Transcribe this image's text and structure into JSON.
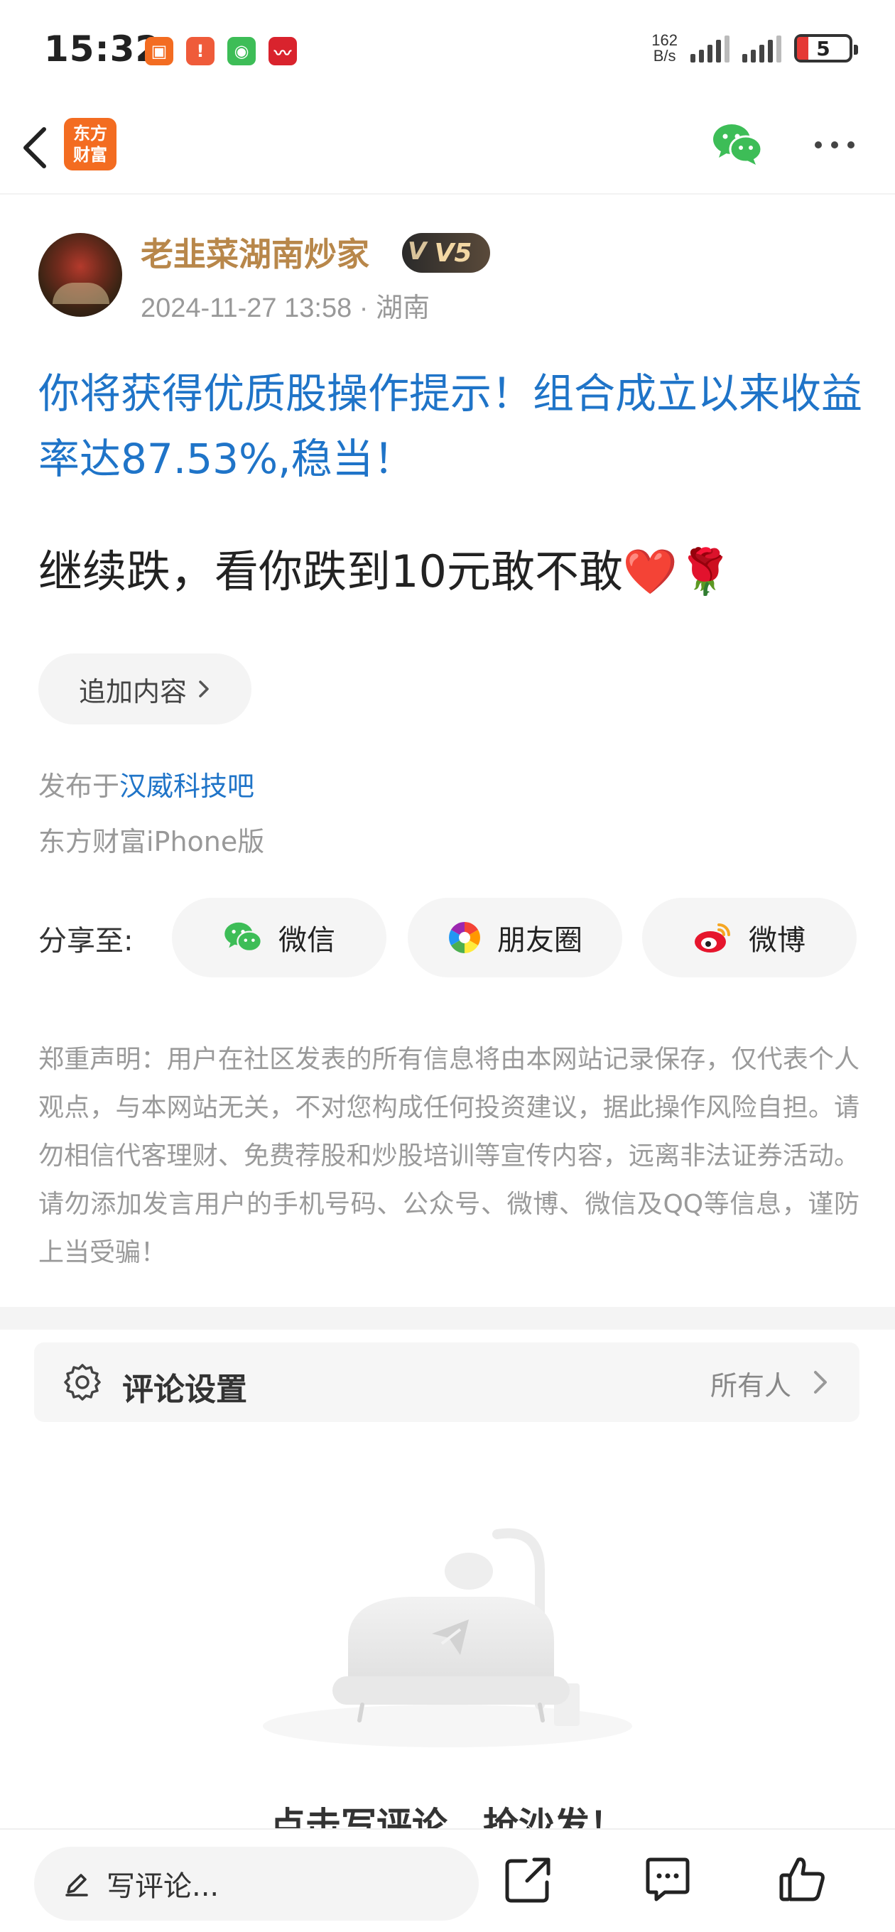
{
  "status_bar": {
    "time": "15:32",
    "net_speed_value": "162",
    "net_speed_unit": "B/s",
    "battery": "5",
    "notif_icons": [
      "app-icon",
      "alert-icon",
      "wechat-icon",
      "stock-app-icon"
    ]
  },
  "header": {
    "logo_line1": "东方",
    "logo_line2": "财富"
  },
  "author": {
    "name": "老韭菜湖南炒家",
    "level": "V5",
    "date": "2024-11-27 13:58",
    "location_sep": " · ",
    "location": "湖南"
  },
  "post": {
    "promo_title": "你将获得优质股操作提示！组合成立以来收益率达87.53%,稳当！",
    "body_text": "继续跌，看你跌到10元敢不敢",
    "body_emoji_heart": "❤️",
    "body_emoji_rose": "🌹",
    "add_content_label": "追加内容",
    "published_prefix": "发布于",
    "published_bar": "汉威科技吧",
    "client": "东方财富iPhone版"
  },
  "share": {
    "label": "分享至:",
    "wechat": "微信",
    "moments": "朋友圈",
    "weibo": "微博"
  },
  "disclaimer": "郑重声明：用户在社区发表的所有信息将由本网站记录保存，仅代表个人观点，与本网站无关，不对您构成任何投资建议，据此操作风险自担。请勿相信代客理财、免费荐股和炒股培训等宣传内容，远离非法证券活动。请勿添加发言用户的手机号码、公众号、微博、微信及QQ等信息，谨防上当受骗！",
  "comment_settings": {
    "title": "评论设置",
    "value": "所有人"
  },
  "empty_state": {
    "text": "点击写评论，抢沙发！"
  },
  "bottom_bar": {
    "comment_placeholder": "写评论..."
  },
  "colors": {
    "brand_orange": "#f36c21",
    "link_blue": "#1f74c8",
    "author_gold": "#b8874a",
    "wechat_green": "#3dbd57"
  }
}
